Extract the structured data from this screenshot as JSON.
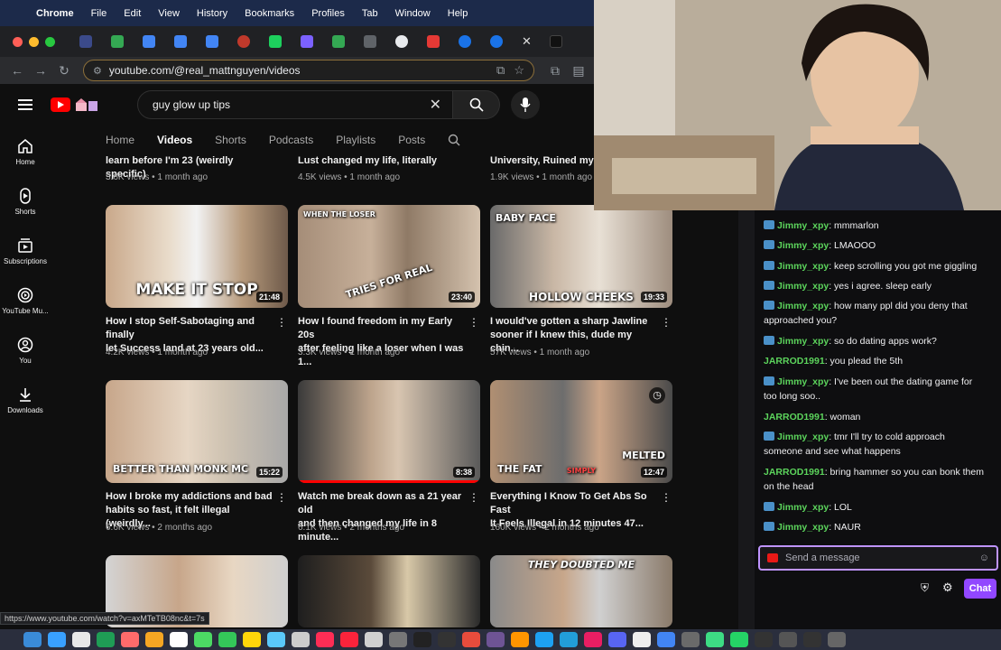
{
  "menubar": {
    "app_name": "Chrome",
    "items": [
      "File",
      "Edit",
      "View",
      "History",
      "Bookmarks",
      "Profiles",
      "Tab",
      "Window",
      "Help"
    ]
  },
  "browser": {
    "url": "youtube.com/@real_mattnguyen/videos",
    "status_url": "https://www.youtube.com/watch?v=axMTeTB08nc&t=7s"
  },
  "youtube": {
    "search_query": "guy glow up tips",
    "guide": [
      {
        "label": "Home",
        "icon": "home-icon"
      },
      {
        "label": "Shorts",
        "icon": "shorts-icon"
      },
      {
        "label": "Subscriptions",
        "icon": "subscriptions-icon"
      },
      {
        "label": "YouTube Mu...",
        "icon": "youtube-music-icon"
      },
      {
        "label": "You",
        "icon": "you-icon"
      },
      {
        "label": "Downloads",
        "icon": "downloads-icon"
      }
    ],
    "channel_tabs": [
      "Home",
      "Videos",
      "Shorts",
      "Podcasts",
      "Playlists",
      "Posts"
    ],
    "top_row": [
      {
        "title": "learn before I'm 23 (weirdly specific)",
        "meta": "3.6K views • 1 month ago"
      },
      {
        "title": "Lust changed my life, literally",
        "meta": "4.5K views • 1 month ago"
      },
      {
        "title": "University, Ruined my bo",
        "meta": "1.9K views • 1 month ago"
      }
    ],
    "videos": [
      {
        "thumb_text": "MAKE IT STOP",
        "duration": "21:48",
        "title1": "How I stop Self-Sabotaging and finally",
        "title2": "let Success land at 23 years old...",
        "meta": "4.2K views • 1 month ago"
      },
      {
        "thumb_text": "TRIES FOR REAL",
        "thumb_text2": "WHEN THE LOSER",
        "duration": "23:40",
        "title1": "How I found freedom in my Early 20s",
        "title2": "after feeling like a loser when I was 1...",
        "meta": "3.3K views • 1 month ago"
      },
      {
        "thumb_text": "HOLLOW CHEEKS",
        "thumb_text2": "BABY FACE",
        "duration": "19:33",
        "title1": "I would've gotten a sharp Jawline",
        "title2": "sooner if I knew this, dude my chin...",
        "meta": "57K views • 1 month ago"
      },
      {
        "thumb_text": "BETTER THAN MONK MC",
        "duration": "15:22",
        "title1": "How I broke my addictions and bad",
        "title2": "habits so fast, it felt illegal (weirdly...",
        "meta": "6.6K views • 2 months ago"
      },
      {
        "thumb_text": "",
        "duration": "8:38",
        "title1": "Watch me break down as a 21 year old",
        "title2": "and then changed my life in 8 minute...",
        "meta": "6.1K views • 2 months ago"
      },
      {
        "thumb_text": "THE FAT",
        "thumb_text2": "MELTED",
        "thumb_text3": "SIMPLY",
        "duration": "12:47",
        "title1": "Everything I Know To Get Abs So Fast",
        "title2": "It Feels Illegal in 12 minutes 47...",
        "meta": "160K views • 2 months ago"
      },
      {
        "thumb_text": "THEY DOUBTED ME"
      }
    ]
  },
  "chat": {
    "messages": [
      {
        "user": "Jimmy_xpy",
        "badge": true,
        "text": "mmmarlon",
        "color": "#5cd45c"
      },
      {
        "user": "Jimmy_xpy",
        "badge": true,
        "text": "LMAOOO",
        "color": "#5cd45c"
      },
      {
        "user": "Jimmy_xpy",
        "badge": true,
        "text": "keep scrolling you got me giggling",
        "color": "#5cd45c"
      },
      {
        "user": "Jimmy_xpy",
        "badge": true,
        "text": "yes i agree. sleep early",
        "color": "#5cd45c"
      },
      {
        "user": "Jimmy_xpy",
        "badge": true,
        "text": "how many ppl did you deny that",
        "text2": "approached you?",
        "color": "#5cd45c"
      },
      {
        "user": "Jimmy_xpy",
        "badge": true,
        "text": "so do dating apps work?",
        "color": "#5cd45c"
      },
      {
        "user": "JARROD1991",
        "badge": false,
        "text": "you plead the 5th",
        "color": "#5cd45c"
      },
      {
        "user": "Jimmy_xpy",
        "badge": true,
        "text": "I've been out the dating game for",
        "text2": "too long soo..",
        "color": "#5cd45c"
      },
      {
        "user": "JARROD1991",
        "badge": false,
        "text": "woman",
        "color": "#5cd45c"
      },
      {
        "user": "Jimmy_xpy",
        "badge": true,
        "text": "tmr I'll try to cold approach",
        "text2": "someone and see what happens",
        "color": "#5cd45c"
      },
      {
        "user": "JARROD1991",
        "badge": false,
        "text": "bring hammer so you can bonk them",
        "text2": "on the head",
        "color": "#5cd45c"
      },
      {
        "user": "Jimmy_xpy",
        "badge": true,
        "text": "LOL",
        "color": "#5cd45c"
      },
      {
        "user": "Jimmy_xpy",
        "badge": true,
        "text": "NAUR",
        "color": "#5cd45c"
      }
    ],
    "input_placeholder": "Send a message",
    "chat_button": "Chat"
  }
}
